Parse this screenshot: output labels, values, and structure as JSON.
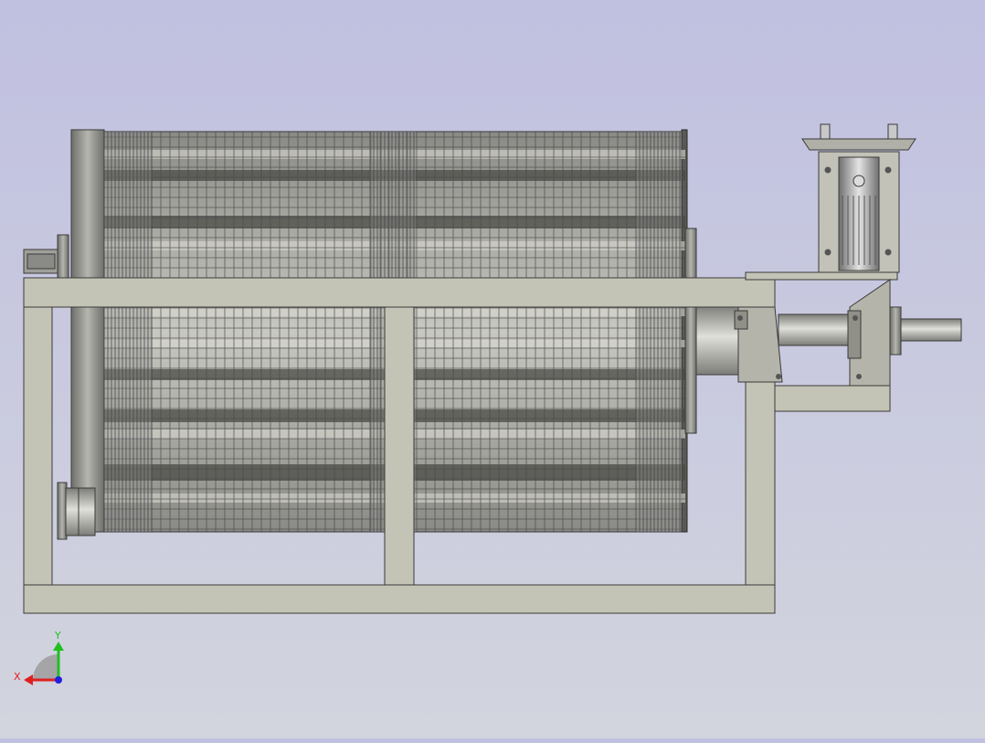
{
  "viewport": {
    "background_top": "#c0c0e0",
    "background_bottom": "#d2d4de"
  },
  "model": {
    "frame_color": "#c4c4b6",
    "edge_color": "#3a3a3a",
    "drum_color": "#a6a6a0",
    "dark_band_color": "#4a4a46"
  },
  "triad": {
    "x_label": "X",
    "y_label": "Y",
    "x_color": "#e02020",
    "y_color": "#20c020",
    "z_color": "#2020e0"
  }
}
